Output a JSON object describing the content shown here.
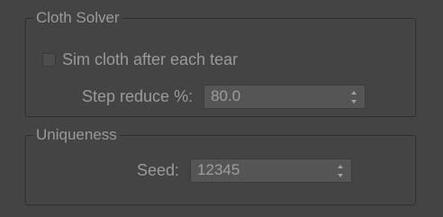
{
  "cloth_solver": {
    "title": "Cloth Solver",
    "sim_cloth_label": "Sim cloth after each tear",
    "sim_cloth_checked": false,
    "step_reduce_label": "Step reduce %:",
    "step_reduce_value": "80.0"
  },
  "uniqueness": {
    "title": "Uniqueness",
    "seed_label": "Seed:",
    "seed_value": "12345"
  },
  "icons": [
    "spinner-arrows-icon"
  ]
}
